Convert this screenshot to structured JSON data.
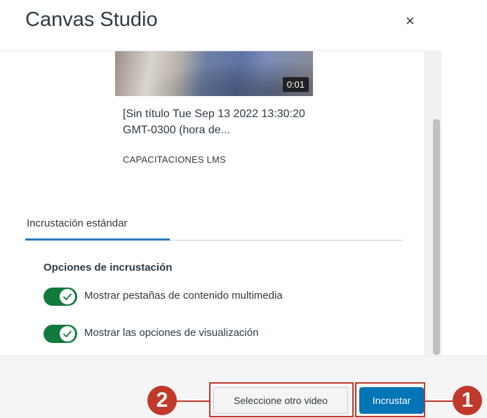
{
  "header": {
    "title": "Canvas Studio",
    "close_glyph": "×"
  },
  "video": {
    "duration": "0:01",
    "title": "[Sin título Tue Sep 13 2022 13:30:20 GMT-0300 (hora de...",
    "owner": "CAPACITACIONES LMS"
  },
  "tabs": [
    {
      "label": "Incrustación estándar",
      "selected": true
    }
  ],
  "embed_options": {
    "heading": "Opciones de incrustación",
    "items": [
      {
        "label": "Mostrar pestañas de contenido multimedia",
        "checked": true
      },
      {
        "label": "Mostrar las opciones de visualización",
        "checked": true
      }
    ]
  },
  "footer": {
    "secondary_label": "Seleccione otro video",
    "primary_label": "Incrustar"
  },
  "annotations": {
    "badge_secondary": "2",
    "badge_primary": "1"
  },
  "colors": {
    "toggle_on": "#127a3d",
    "primary": "#0374b5",
    "tab_indicator": "#2b7abc",
    "annotation": "#c0392b"
  }
}
